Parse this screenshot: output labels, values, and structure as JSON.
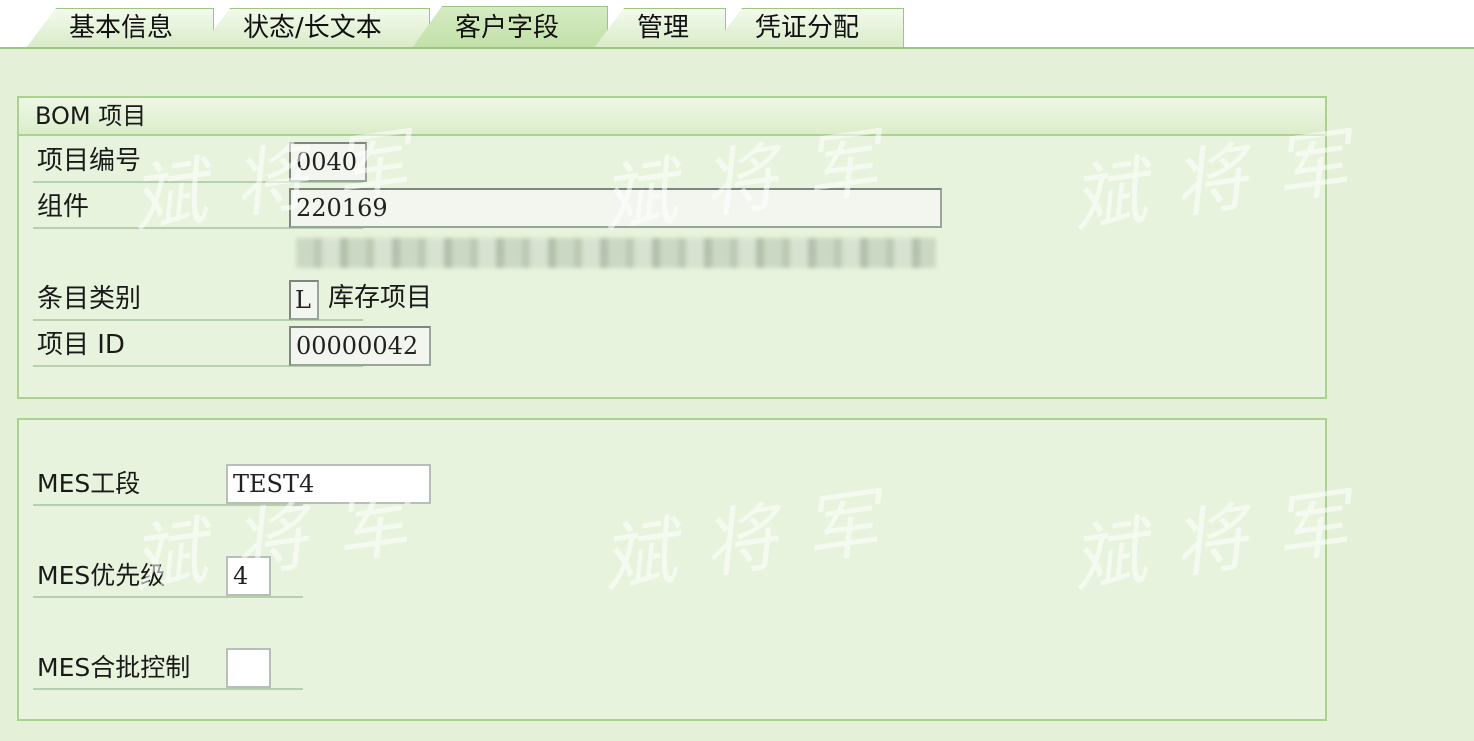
{
  "tabs": [
    {
      "label": "基本信息"
    },
    {
      "label": "状态/长文本"
    },
    {
      "label": "客户字段"
    },
    {
      "label": "管理"
    },
    {
      "label": "凭证分配"
    }
  ],
  "bom_group": {
    "title": "BOM 项目",
    "item_number_label": "项目编号",
    "item_number_value": "0040",
    "component_label": "组件",
    "component_value": "220169",
    "item_category_label": "条目类别",
    "item_category_code": "L",
    "item_category_text": "库存项目",
    "item_id_label": "项目 ID",
    "item_id_value": "00000042"
  },
  "mes_group": {
    "section_label": "MES工段",
    "section_value": "TEST4",
    "priority_label": "MES优先级",
    "priority_value": "4",
    "batch_label": "MES合批控制",
    "batch_value": ""
  },
  "watermark": "斌将军"
}
